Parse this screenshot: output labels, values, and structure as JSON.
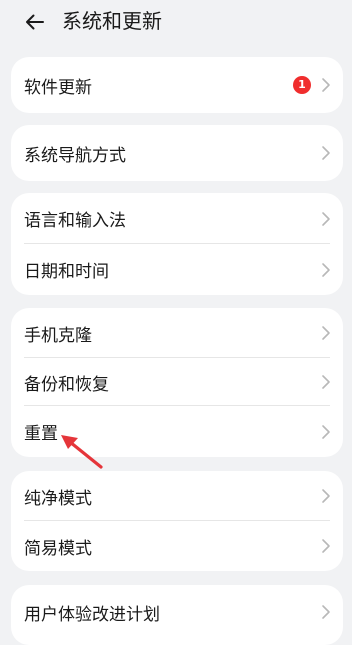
{
  "header": {
    "title": "系统和更新",
    "back_icon": "arrow-left-icon"
  },
  "sections": [
    {
      "items": [
        {
          "label": "软件更新",
          "badge": "1"
        }
      ]
    },
    {
      "items": [
        {
          "label": "系统导航方式"
        }
      ]
    },
    {
      "items": [
        {
          "label": "语言和输入法"
        },
        {
          "label": "日期和时间"
        }
      ]
    },
    {
      "items": [
        {
          "label": "手机克隆"
        },
        {
          "label": "备份和恢复"
        },
        {
          "label": "重置"
        }
      ]
    },
    {
      "items": [
        {
          "label": "纯净模式"
        },
        {
          "label": "简易模式"
        }
      ]
    },
    {
      "items": [
        {
          "label": "用户体验改进计划"
        }
      ]
    }
  ],
  "colors": {
    "background": "#f1f2f4",
    "card": "#ffffff",
    "badge": "#f02d2d",
    "annotation_arrow": "#e5353a"
  }
}
